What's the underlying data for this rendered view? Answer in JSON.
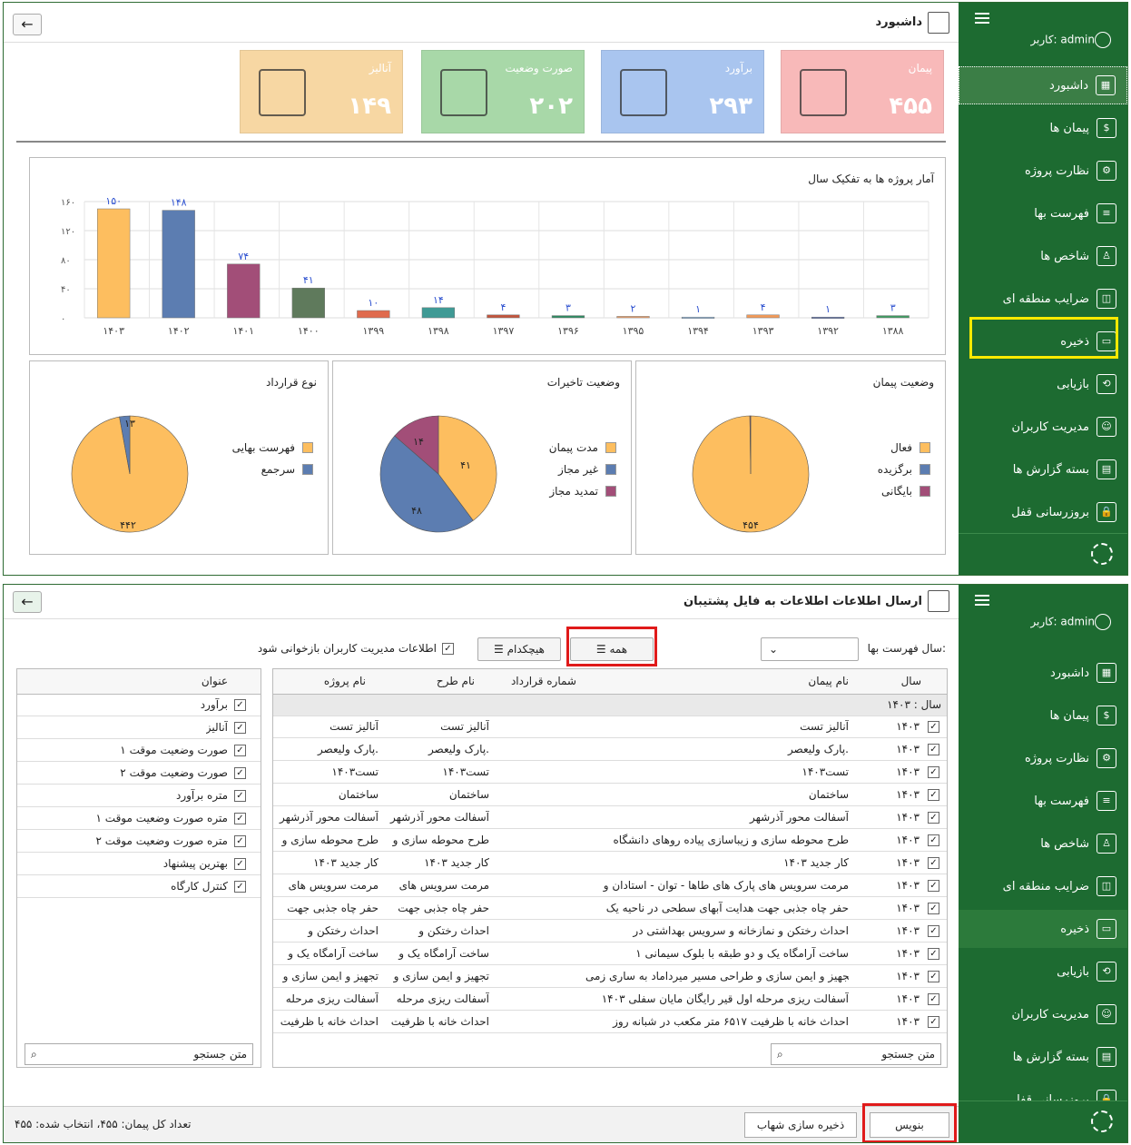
{
  "sidebar": {
    "user": "کاربر: admin",
    "items": [
      {
        "label": "داشبورد",
        "icon": "dashboard-icon",
        "glyph": "▦"
      },
      {
        "label": "پیمان ها",
        "icon": "contracts-icon",
        "glyph": "$"
      },
      {
        "label": "نظارت پروژه",
        "icon": "supervision-icon",
        "glyph": "⚙"
      },
      {
        "label": "فهرست بها",
        "icon": "pricelist-icon",
        "glyph": "≡"
      },
      {
        "label": "شاخص ها",
        "icon": "indices-icon",
        "glyph": "♙"
      },
      {
        "label": "ضرایب منطقه ای",
        "icon": "regional-coef-icon",
        "glyph": "◫"
      },
      {
        "label": "ذخیره",
        "icon": "save-icon",
        "glyph": "▭"
      },
      {
        "label": "بازیابی",
        "icon": "restore-icon",
        "glyph": "⟲"
      },
      {
        "label": "مدیریت کاربران",
        "icon": "users-icon",
        "glyph": "☺"
      },
      {
        "label": "بسته گزارش ها",
        "icon": "reports-icon",
        "glyph": "▤"
      },
      {
        "label": "بروزرسانی قفل",
        "icon": "lock-icon",
        "glyph": "🔒"
      }
    ]
  },
  "dashboard": {
    "title": "داشبورد",
    "back": "←",
    "kpis": [
      {
        "label": "پیمان",
        "value": "۴۵۵",
        "color": "#f8b9b9",
        "icon": "contract-money-icon"
      },
      {
        "label": "برآورد",
        "value": "۲۹۳",
        "color": "#a9c5ef",
        "icon": "invoice-calculator-icon"
      },
      {
        "label": "صورت وضعیت",
        "value": "۲۰۲",
        "color": "#a8d8a8",
        "icon": "status-report-icon"
      },
      {
        "label": "آنالیز",
        "value": "۱۴۹",
        "color": "#f7d7a3",
        "icon": "analysis-chart-icon"
      }
    ],
    "bar_title": "آمار پروژه ها به تفکیک سال",
    "pie1": {
      "title": "وضعیت پیمان",
      "legend": [
        "فعال",
        "برگزیده",
        "بایگانی"
      ],
      "labels": [
        "۴۵۴"
      ]
    },
    "pie2": {
      "title": "وضعیت تاخیرات",
      "legend": [
        "مدت پیمان",
        "غیر مجاز",
        "تمدید مجاز"
      ],
      "labels": [
        "۴۱",
        "۴۸",
        "۱۴"
      ]
    },
    "pie3": {
      "title": "نوع قرارداد",
      "legend": [
        "فهرست بهایی",
        "سرجمع"
      ],
      "labels": [
        "۴۴۲",
        "۱۳"
      ]
    }
  },
  "chart_data": [
    {
      "type": "bar",
      "title": "آمار پروژه ها به تفکیک سال",
      "categories": [
        "۱۴۰۳",
        "۱۴۰۲",
        "۱۴۰۱",
        "۱۴۰۰",
        "۱۳۹۹",
        "۱۳۹۸",
        "۱۳۹۷",
        "۱۳۹۶",
        "۱۳۹۵",
        "۱۳۹۴",
        "۱۳۹۳",
        "۱۳۹۲",
        "۱۳۸۸"
      ],
      "values": [
        150,
        148,
        74,
        41,
        10,
        14,
        4,
        3,
        2,
        1,
        4,
        1,
        3
      ],
      "value_labels": [
        "۱۵۰",
        "۱۴۸",
        "۷۴",
        "۴۱",
        "۱۰",
        "۱۴",
        "۴",
        "۳",
        "۲",
        "۱",
        "۴",
        "۱",
        "۳"
      ],
      "colors": [
        "#fdbe5f",
        "#5c7db1",
        "#a24e78",
        "#5f7a5c",
        "#e06b4e",
        "#3f9a95",
        "#c1553d",
        "#2e8a62",
        "#f0a26a",
        "#8fb4d9",
        "#f29a58",
        "#5b6ea8",
        "#3f9a60"
      ],
      "ylim": [
        0,
        160
      ],
      "yticks": [
        "۰",
        "۴۰",
        "۸۰",
        "۱۲۰",
        "۱۶۰"
      ],
      "grid": true
    },
    {
      "type": "pie",
      "title": "وضعیت پیمان",
      "categories": [
        "فعال",
        "برگزیده",
        "بایگانی"
      ],
      "values": [
        454,
        0,
        1
      ],
      "colors": [
        "#fdbe5f",
        "#5c7db1",
        "#a24e78"
      ]
    },
    {
      "type": "pie",
      "title": "وضعیت تاخیرات",
      "categories": [
        "مدت پیمان",
        "غیر مجاز",
        "تمدید مجاز"
      ],
      "values": [
        41,
        48,
        14
      ],
      "colors": [
        "#fdbe5f",
        "#5c7db1",
        "#a24e78"
      ]
    },
    {
      "type": "pie",
      "title": "نوع قرارداد",
      "categories": [
        "فهرست بهایی",
        "سرجمع"
      ],
      "values": [
        442,
        13
      ],
      "colors": [
        "#fdbe5f",
        "#5c7db1"
      ]
    }
  ],
  "backup": {
    "title": "ارسال اطلاعات اطلاعات به فایل پشتیبان",
    "year_label": "سال فهرست بها:",
    "all": "همه",
    "none": "هیچکدام",
    "users_check": "اطلاعات مدیریت کاربران بازخوانی شود",
    "cols": {
      "year": "سال",
      "name": "نام پیمان",
      "contract_no": "شماره قرارداد",
      "plan": "نام طرح",
      "project": "نام پروژه"
    },
    "group": "سال : ۱۴۰۳",
    "rows": [
      {
        "year": "۱۴۰۳",
        "name": "آنالیز تست",
        "plan": "آنالیز تست",
        "project": "آنالیز تست"
      },
      {
        "year": "۱۴۰۳",
        "name": "پارک ولیعصر.",
        "plan": "پارک ولیعصر.",
        "project": "پارک ولیعصر."
      },
      {
        "year": "۱۴۰۳",
        "name": "تست۱۴۰۳",
        "plan": "تست۱۴۰۳",
        "project": "تست۱۴۰۳"
      },
      {
        "year": "۱۴۰۳",
        "name": "ساختمان",
        "plan": "ساختمان",
        "project": "ساختمان"
      },
      {
        "year": "۱۴۰۳",
        "name": "آسفالت محور آذرشهر",
        "plan": "آسفالت محور آذرشهر",
        "project": "آسفالت محور آذرشهر"
      },
      {
        "year": "۱۴۰۳",
        "name": "طرح محوطه سازی و زیباسازی پیاده روهای دانشگاه",
        "plan": "طرح محوطه سازی و",
        "project": "طرح محوطه سازی و"
      },
      {
        "year": "۱۴۰۳",
        "name": "کار جدید ۱۴۰۳",
        "plan": "کار جدید ۱۴۰۳",
        "project": "کار جدید ۱۴۰۳"
      },
      {
        "year": "۱۴۰۳",
        "name": "مرمت سرویس های پارک های طاها - توان - استادان و",
        "plan": "مرمت سرویس های",
        "project": "مرمت سرویس های"
      },
      {
        "year": "۱۴۰۳",
        "name": "حفر چاه جذبی جهت هدایت آبهای سطحی در ناحیه یک",
        "plan": "حفر چاه جذبی جهت",
        "project": "حفر چاه جذبی جهت"
      },
      {
        "year": "۱۴۰۳",
        "name": "احداث رختکن و نمازخانه و سرویس بهداشتی در",
        "plan": "احداث رختکن و",
        "project": "احداث رختکن و"
      },
      {
        "year": "۱۴۰۳",
        "name": "ساخت آرامگاه یک و دو طبقه با بلوک سیمانی ۱",
        "plan": "ساخت آرامگاه یک و",
        "project": "ساخت آرامگاه یک و"
      },
      {
        "year": "۱۴۰۳",
        "name": "تجهیز و ایمن سازی و طراحی مسیر میرداماد به ساری زمی",
        "plan": "تجهیز و ایمن سازی و",
        "project": "تجهیز و ایمن سازی و"
      },
      {
        "year": "۱۴۰۳",
        "name": "آسفالت ریزی مرحله اول قیر رایگان مایان سفلی ۱۴۰۳",
        "plan": "آسفالت ریزی مرحله",
        "project": "آسفالت ریزی مرحله"
      },
      {
        "year": "۱۴۰۳",
        "name": "احداث خانه با ظرفیت ۶۵۱۷ متر مکعب در شبانه روز",
        "plan": "احداث خانه با ظرفیت",
        "project": "احداث خانه با ظرفیت"
      }
    ],
    "side_title": "عنوان",
    "side_items": [
      "برآورد",
      "آنالیز",
      "صورت وضعیت موقت ۱",
      "صورت وضعیت موقت ۲",
      "متره برآورد",
      "متره صورت وضعیت موقت ۱",
      "متره صورت وضعیت موقت ۲",
      "بهترین پیشنهاد",
      "کنترل کارگاه"
    ],
    "search": "متن جستجو",
    "write": "بنویس",
    "shahab": "ذخیره سازی شهاب",
    "footer": "تعداد کل پیمان: ۴۵۵، انتخاب شده: ۴۵۵"
  }
}
